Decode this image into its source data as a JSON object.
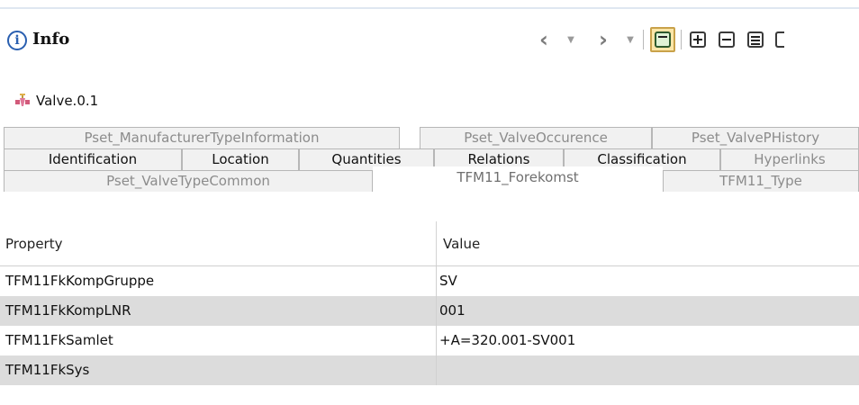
{
  "header": {
    "title": "Info",
    "info_icon": "info-icon",
    "toolbar": {
      "icons": [
        "back-arrow-icon",
        "back-dropdown-icon",
        "forward-arrow-icon",
        "forward-dropdown-icon",
        "sync-selection-icon",
        "expand-all-icon",
        "collapse-all-icon",
        "details-icon",
        "more-icon"
      ]
    }
  },
  "object": {
    "icon": "valve-icon",
    "name": "Valve.0.1"
  },
  "tabs": {
    "row1": [
      "Pset_ManufacturerTypeInformation",
      "Pset_ValveOccurence",
      "Pset_ValvePHistory"
    ],
    "row2": [
      "Identification",
      "Location",
      "Quantities",
      "Relations",
      "Classification",
      "Hyperlinks"
    ],
    "row3": [
      "Pset_ValveTypeCommon",
      "TFM11_Forekomst",
      "TFM11_Type"
    ],
    "selected": "TFM11_Forekomst"
  },
  "table": {
    "headers": {
      "property": "Property",
      "value": "Value"
    },
    "rows": [
      {
        "property": "TFM11FkKompGruppe",
        "value": "SV"
      },
      {
        "property": "TFM11FkKompLNR",
        "value": "001"
      },
      {
        "property": "TFM11FkSamlet",
        "value": "+A=320.001-SV001"
      },
      {
        "property": "TFM11FkSys",
        "value": ""
      }
    ]
  },
  "colors": {
    "accent_border": "#c9a24a",
    "accent_fill": "#fbe6a8",
    "info_blue": "#2a5fb0",
    "alt_row": "#dcdcdc",
    "tab_bg": "#f1f1f1"
  }
}
